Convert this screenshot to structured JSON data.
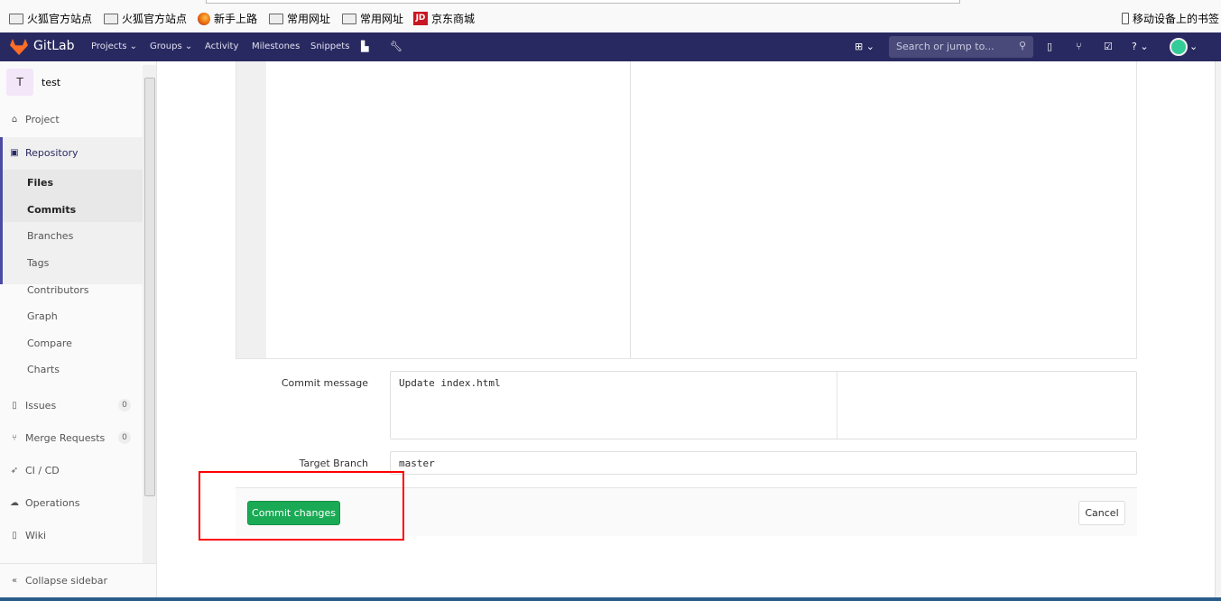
{
  "bookmarks": [
    "火狐官方站点",
    "火狐官方站点",
    "新手上路",
    "常用网址",
    "常用网址",
    "京东商城"
  ],
  "mobile_bookmarks": "移动设备上的书签",
  "nav": {
    "brand": "GitLab",
    "items": [
      "Projects ⌄",
      "Groups ⌄",
      "Activity",
      "Milestones",
      "Snippets"
    ],
    "search_placeholder": "Search or jump to..."
  },
  "sidebar": {
    "avatar": "T",
    "project": "test",
    "project_label": "Project",
    "repository": "Repository",
    "sub": [
      "Files",
      "Commits",
      "Branches",
      "Tags",
      "Contributors",
      "Graph",
      "Compare",
      "Charts"
    ],
    "issues": "Issues",
    "issues_count": "0",
    "mr": "Merge Requests",
    "mr_count": "0",
    "cicd": "CI / CD",
    "ops": "Operations",
    "wiki": "Wiki",
    "collapse": "Collapse sidebar"
  },
  "form": {
    "commit_label": "Commit message",
    "commit_value": "Update index.html",
    "branch_label": "Target Branch",
    "branch_value": "master",
    "commit_button": "Commit changes",
    "cancel_button": "Cancel"
  },
  "colors": {
    "nav": "#292961",
    "commit": "#1aaa55",
    "highlight": "#ff0000"
  }
}
